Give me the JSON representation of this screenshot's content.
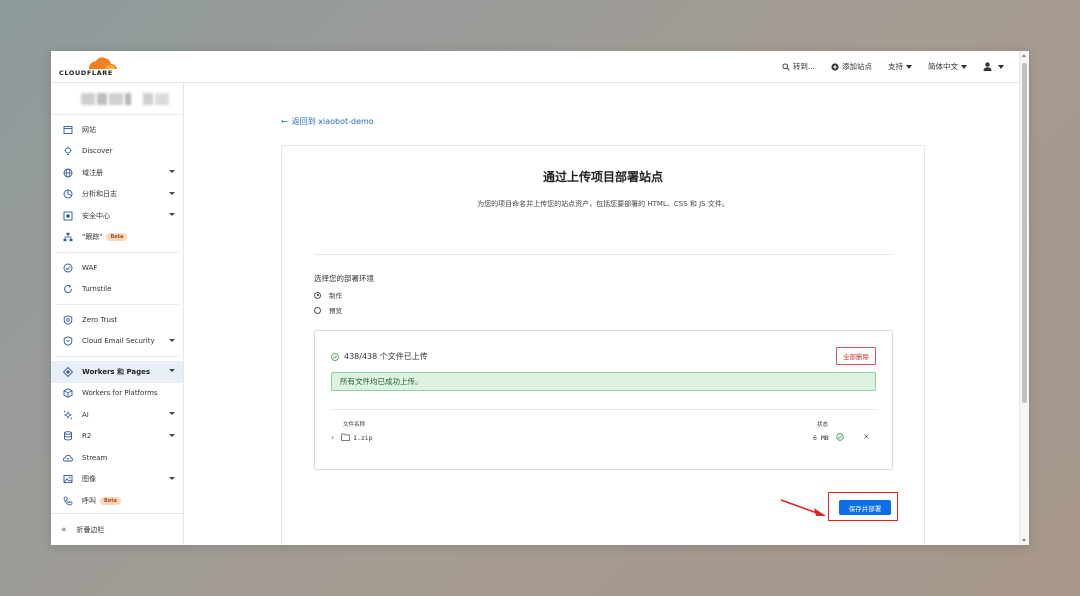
{
  "brand": {
    "name": "CLOUDFLARE",
    "accent": "#f38020"
  },
  "topbar": {
    "goto_label": "转到...",
    "add_site_label": "添加站点",
    "support_label": "支持",
    "language_label": "简体中文"
  },
  "sidebar": {
    "items": [
      {
        "label": "网站",
        "icon": "browser-icon",
        "dropdown": false
      },
      {
        "label": "Discover",
        "icon": "lightbulb-icon",
        "dropdown": false
      },
      {
        "label": "域注册",
        "icon": "globe-icon",
        "dropdown": true
      },
      {
        "label": "分析和日志",
        "icon": "chart-icon",
        "dropdown": true
      },
      {
        "label": "安全中心",
        "icon": "shield-icon",
        "dropdown": true
      },
      {
        "label": "\"跟踪\"",
        "icon": "sitemap-icon",
        "dropdown": false,
        "badge": "Beta"
      },
      {
        "label": "WAF",
        "icon": "waf-icon",
        "dropdown": false
      },
      {
        "label": "Turnstile",
        "icon": "refresh-icon",
        "dropdown": false
      },
      {
        "label": "Zero Trust",
        "icon": "zero-trust-icon",
        "dropdown": false
      },
      {
        "label": "Cloud Email Security",
        "icon": "email-shield-icon",
        "dropdown": true
      },
      {
        "label": "Workers 和 Pages",
        "icon": "workers-icon",
        "dropdown": true,
        "active": true
      },
      {
        "label": "Workers for Platforms",
        "icon": "cube-icon",
        "dropdown": false
      },
      {
        "label": "AI",
        "icon": "ai-icon",
        "dropdown": true
      },
      {
        "label": "R2",
        "icon": "database-icon",
        "dropdown": true
      },
      {
        "label": "Stream",
        "icon": "cloud-play-icon",
        "dropdown": false
      },
      {
        "label": "图像",
        "icon": "image-icon",
        "dropdown": true
      },
      {
        "label": "呼叫",
        "icon": "phone-icon",
        "dropdown": false,
        "badge": "Beta"
      }
    ],
    "collapse_label": "折叠边栏"
  },
  "main": {
    "back_label": "返回到 xiaobot-demo",
    "title": "通过上传项目部署站点",
    "description": "为您的项目命名并上传您的站点资产，包括您要部署的 HTML、CSS 和 JS 文件。",
    "env_label": "选择您的部署环境",
    "env_options": [
      {
        "label": "制作",
        "selected": true
      },
      {
        "label": "预览",
        "selected": false
      }
    ],
    "upload": {
      "status": "438/438 个文件已上传",
      "delete_all_label": "全部删除",
      "success_message": "所有文件均已成功上传。",
      "col_name": "文件名称",
      "col_status": "状态",
      "files": [
        {
          "name": "1.zip",
          "size": "6 MB"
        }
      ]
    },
    "save_label": "保存并部署"
  },
  "colors": {
    "primary": "#0a6fe8",
    "danger": "#e02424",
    "success_bg": "#def2e2"
  }
}
